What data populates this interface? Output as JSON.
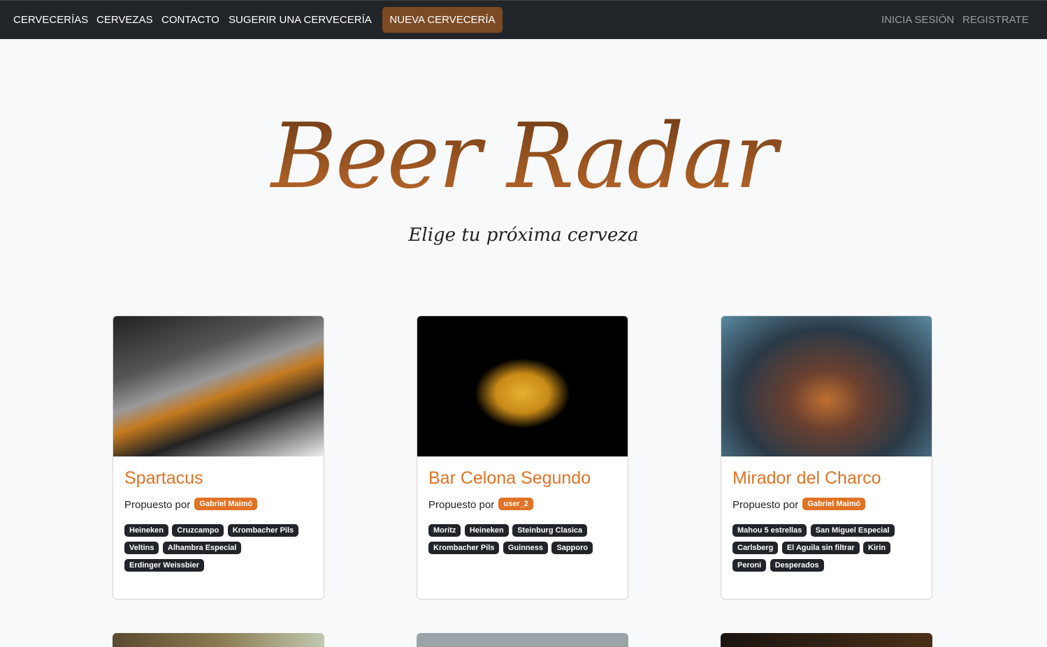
{
  "nav": {
    "items": [
      "CERVECERÍAS",
      "CERVEZAS",
      "CONTACTO",
      "SUGERIR UNA CERVECERÍA"
    ],
    "new_button": "NUEVA CERVECERÍA",
    "login": "INICIA SESIÓN",
    "register": "REGISTRATE"
  },
  "hero": {
    "title": "Beer Radar",
    "subtitle": "Elige tu próxima cerveza"
  },
  "proposed_label": "Propuesto por",
  "cards": [
    {
      "name": "Spartacus",
      "user": "Gabriel Maimó",
      "beers": [
        "Heineken",
        "Cruzcampo",
        "Krombacher Pils",
        "Veltins",
        "Alhambra Especial",
        "Erdinger Weissbier"
      ]
    },
    {
      "name": "Bar Celona Segundo",
      "user": "user_2",
      "beers": [
        "Moritz",
        "Heineken",
        "Steinburg Clasica",
        "Krombacher Pils",
        "Guinness",
        "Sapporo"
      ]
    },
    {
      "name": "Mirador del Charco",
      "user": "Gabriel Maimó",
      "beers": [
        "Mahou 5 estrellas",
        "San Miguel Especial",
        "Carlsberg",
        "El Aguila sin filtrar",
        "Kirin",
        "Peroni",
        "Desperados"
      ]
    }
  ]
}
